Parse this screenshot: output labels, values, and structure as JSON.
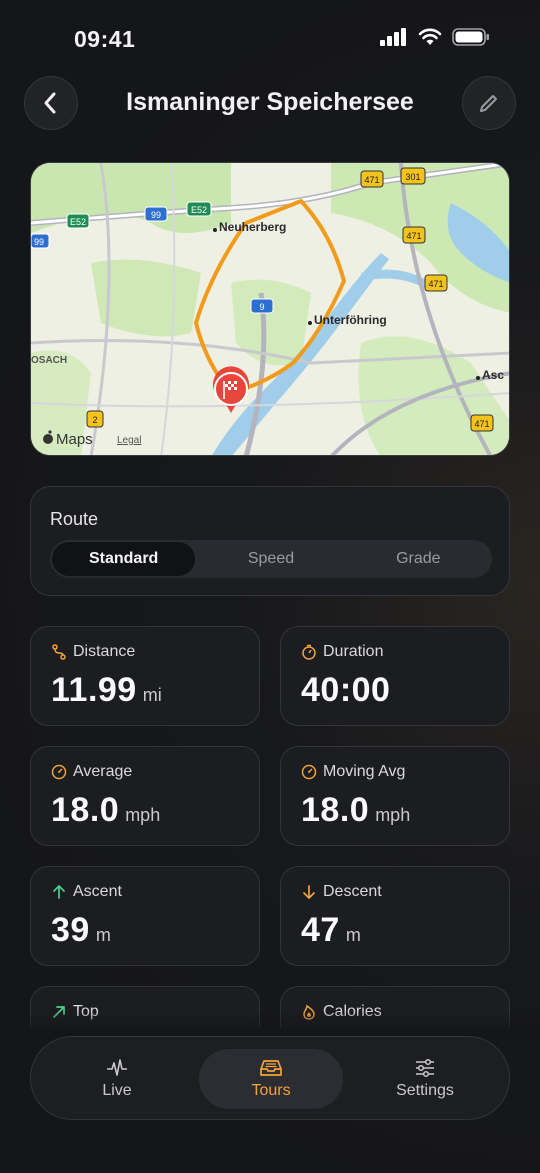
{
  "status": {
    "time": "09:41"
  },
  "header": {
    "title": "Ismaninger Speichersee"
  },
  "map": {
    "places": [
      "Neuherberg",
      "Unterföhring",
      "Asc",
      "OSACH"
    ],
    "road_badges": [
      "E52",
      "99",
      "E52",
      "99",
      "471",
      "301",
      "471",
      "471",
      "9",
      "2",
      "471"
    ],
    "attribution": "Maps",
    "legal": "Legal",
    "route_color": "#f29a1a",
    "pin_color": "#e8453c"
  },
  "route": {
    "label": "Route",
    "options": [
      "Standard",
      "Speed",
      "Grade"
    ],
    "selected": "Standard"
  },
  "stats": [
    {
      "label": "Distance",
      "value": "11.99",
      "unit": "mi",
      "icon": "route-icon"
    },
    {
      "label": "Duration",
      "value": "40:00",
      "unit": "",
      "icon": "timer-icon"
    },
    {
      "label": "Average",
      "value": "18.0",
      "unit": "mph",
      "icon": "speedometer-icon"
    },
    {
      "label": "Moving Avg",
      "value": "18.0",
      "unit": "mph",
      "icon": "speedometer-icon"
    },
    {
      "label": "Ascent",
      "value": "39",
      "unit": "m",
      "icon": "arrow-up-icon"
    },
    {
      "label": "Descent",
      "value": "47",
      "unit": "m",
      "icon": "arrow-down-icon"
    },
    {
      "label": "Top",
      "value": "",
      "unit": "",
      "icon": "arrow-up-right-icon"
    },
    {
      "label": "Calories",
      "value": "",
      "unit": "",
      "icon": "flame-icon"
    }
  ],
  "tabs": [
    {
      "label": "Live",
      "icon": "pulse-icon"
    },
    {
      "label": "Tours",
      "icon": "tray-icon"
    },
    {
      "label": "Settings",
      "icon": "sliders-icon"
    }
  ],
  "colors": {
    "accent": "#f2a33a",
    "green": "#4fd08a",
    "background": "#141518"
  }
}
